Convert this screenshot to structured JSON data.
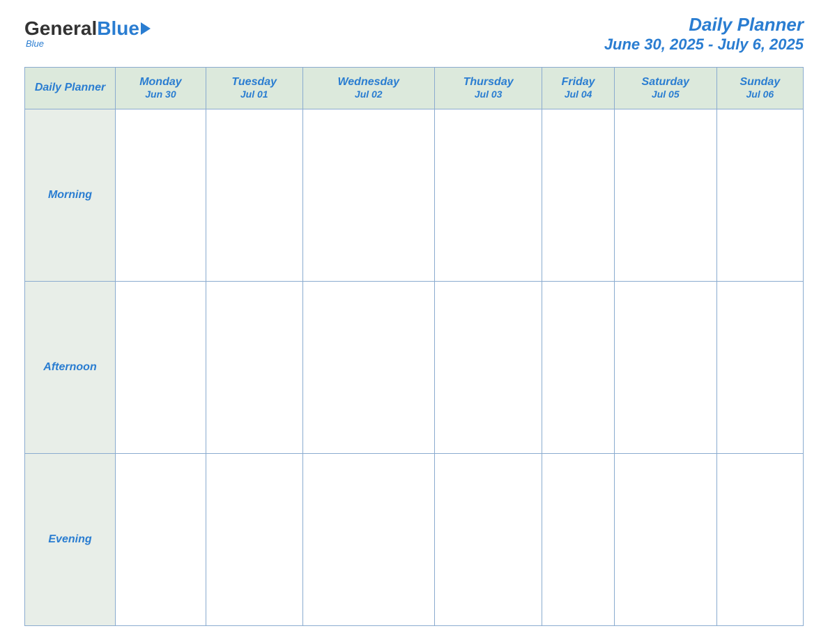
{
  "logo": {
    "general": "General",
    "blue": "Blue",
    "subtitle": "Blue"
  },
  "header": {
    "title": "Daily Planner",
    "date_range": "June 30, 2025 - July 6, 2025"
  },
  "table": {
    "label_header": "Daily Planner",
    "days": [
      {
        "name": "Monday",
        "date": "Jun 30"
      },
      {
        "name": "Tuesday",
        "date": "Jul 01"
      },
      {
        "name": "Wednesday",
        "date": "Jul 02"
      },
      {
        "name": "Thursday",
        "date": "Jul 03"
      },
      {
        "name": "Friday",
        "date": "Jul 04"
      },
      {
        "name": "Saturday",
        "date": "Jul 05"
      },
      {
        "name": "Sunday",
        "date": "Jul 06"
      }
    ],
    "time_slots": [
      {
        "label": "Morning"
      },
      {
        "label": "Afternoon"
      },
      {
        "label": "Evening"
      }
    ]
  }
}
